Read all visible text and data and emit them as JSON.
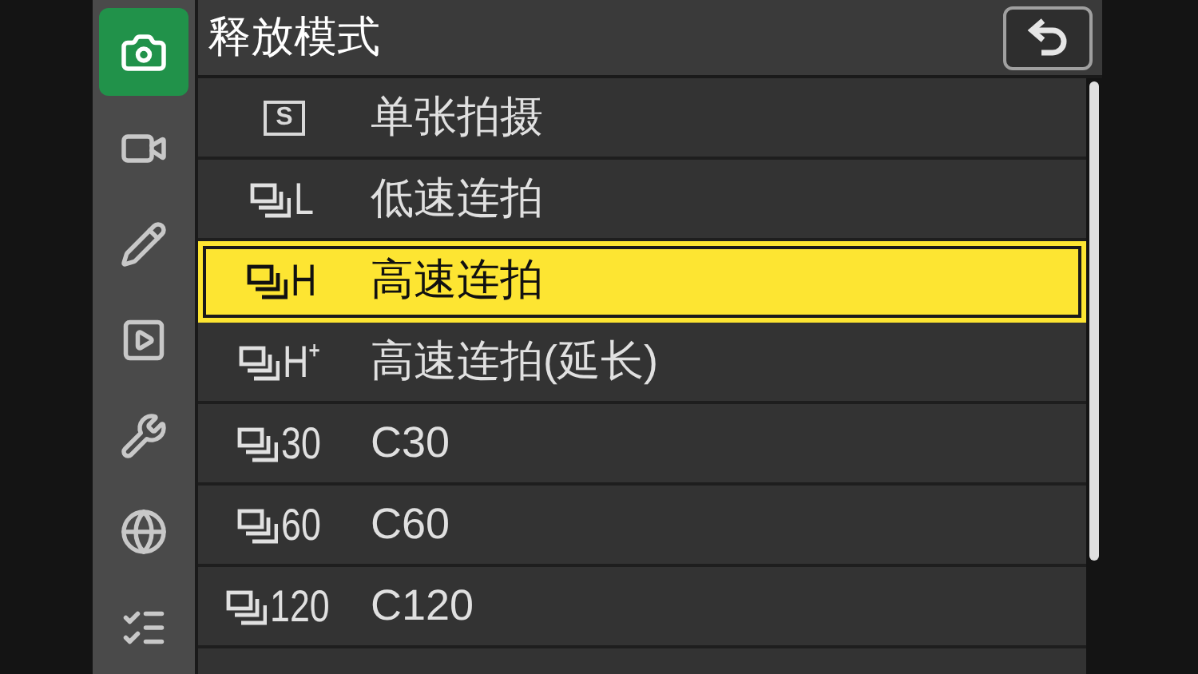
{
  "sidebar": {
    "items": [
      {
        "kind": "photo",
        "selected": true
      },
      {
        "kind": "movie",
        "selected": false
      },
      {
        "kind": "custom",
        "selected": false
      },
      {
        "kind": "playback",
        "selected": false
      },
      {
        "kind": "setup",
        "selected": false
      },
      {
        "kind": "network",
        "selected": false
      },
      {
        "kind": "mymenu",
        "selected": false
      }
    ]
  },
  "header": {
    "title": "释放模式"
  },
  "menu": {
    "items": [
      {
        "kind": "single",
        "icon_text": "S",
        "label": "单张拍摄",
        "selected": false
      },
      {
        "kind": "continuous",
        "icon_text": "L",
        "label": "低速连拍",
        "selected": false
      },
      {
        "kind": "continuous",
        "icon_text": "H",
        "label": "高速连拍",
        "selected": true
      },
      {
        "kind": "continuous",
        "icon_text": "H⁺",
        "label": "高速连拍(延长)",
        "selected": false
      },
      {
        "kind": "continuous",
        "icon_text": "30",
        "label": "C30",
        "selected": false
      },
      {
        "kind": "continuous",
        "icon_text": "60",
        "label": "C60",
        "selected": false
      },
      {
        "kind": "continuous",
        "icon_text": "120",
        "label": "C120",
        "selected": false
      }
    ]
  }
}
